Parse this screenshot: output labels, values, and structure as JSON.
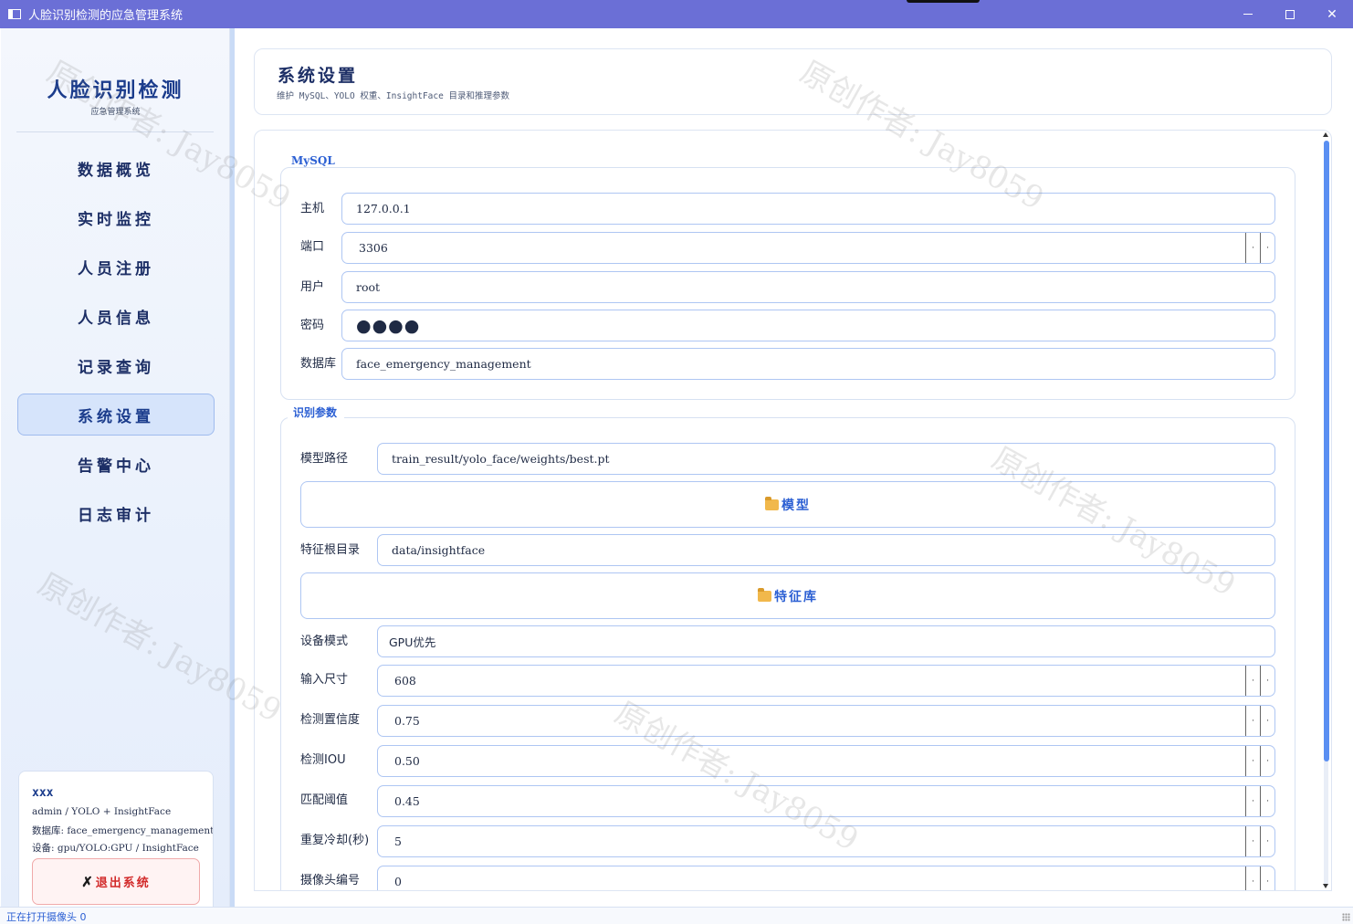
{
  "window": {
    "title": "人脸识别检测的应急管理系统"
  },
  "sidebar": {
    "brand_title": "人脸识别检测",
    "brand_subtitle": "应急管理系统",
    "nav": [
      {
        "label": "数据概览",
        "active": false
      },
      {
        "label": "实时监控",
        "active": false
      },
      {
        "label": "人员注册",
        "active": false
      },
      {
        "label": "人员信息",
        "active": false
      },
      {
        "label": "记录查询",
        "active": false
      },
      {
        "label": "系统设置",
        "active": true
      },
      {
        "label": "告警中心",
        "active": false
      },
      {
        "label": "日志审计",
        "active": false
      }
    ],
    "user": {
      "name": "xxx",
      "role_line": "admin / YOLO + InsightFace",
      "db_line": "数据库: face_emergency_management",
      "device_line": "设备: gpu/YOLO:GPU / InsightFace"
    },
    "logout_label": "退出系统"
  },
  "header": {
    "title": "系统设置",
    "subtitle": "维护 MySQL、YOLO 权重、InsightFace 目录和推理参数"
  },
  "mysql": {
    "group_title": "MySQL",
    "host_label": "主机",
    "host_value": "127.0.0.1",
    "port_label": "端口",
    "port_value": "3306",
    "user_label": "用户",
    "user_value": "root",
    "password_label": "密码",
    "password_value": "●●●●",
    "database_label": "数据库",
    "database_value": "face_emergency_management"
  },
  "recognition": {
    "group_title": "识别参数",
    "model_path_label": "模型路径",
    "model_path_value": "train_result/yolo_face/weights/best.pt",
    "model_button": "模型",
    "feature_dir_label": "特征根目录",
    "feature_dir_value": "data/insightface",
    "feature_button": "特征库",
    "device_label": "设备模式",
    "device_value": "GPU优先",
    "input_size_label": "输入尺寸",
    "input_size_value": "608",
    "conf_label": "检测置信度",
    "conf_value": "0.75",
    "iou_label": "检测IOU",
    "iou_value": "0.50",
    "match_label": "匹配阈值",
    "match_value": "0.45",
    "cooldown_label": "重复冷却(秒)",
    "cooldown_value": "5",
    "camera_label": "摄像头编号",
    "camera_value": "0"
  },
  "watermark": {
    "text": "原创作者: Jay8059"
  },
  "status": {
    "text": "正在打开摄像头 0"
  },
  "icons": {
    "folder": "folder-icon",
    "logout": "close-x-icon"
  }
}
